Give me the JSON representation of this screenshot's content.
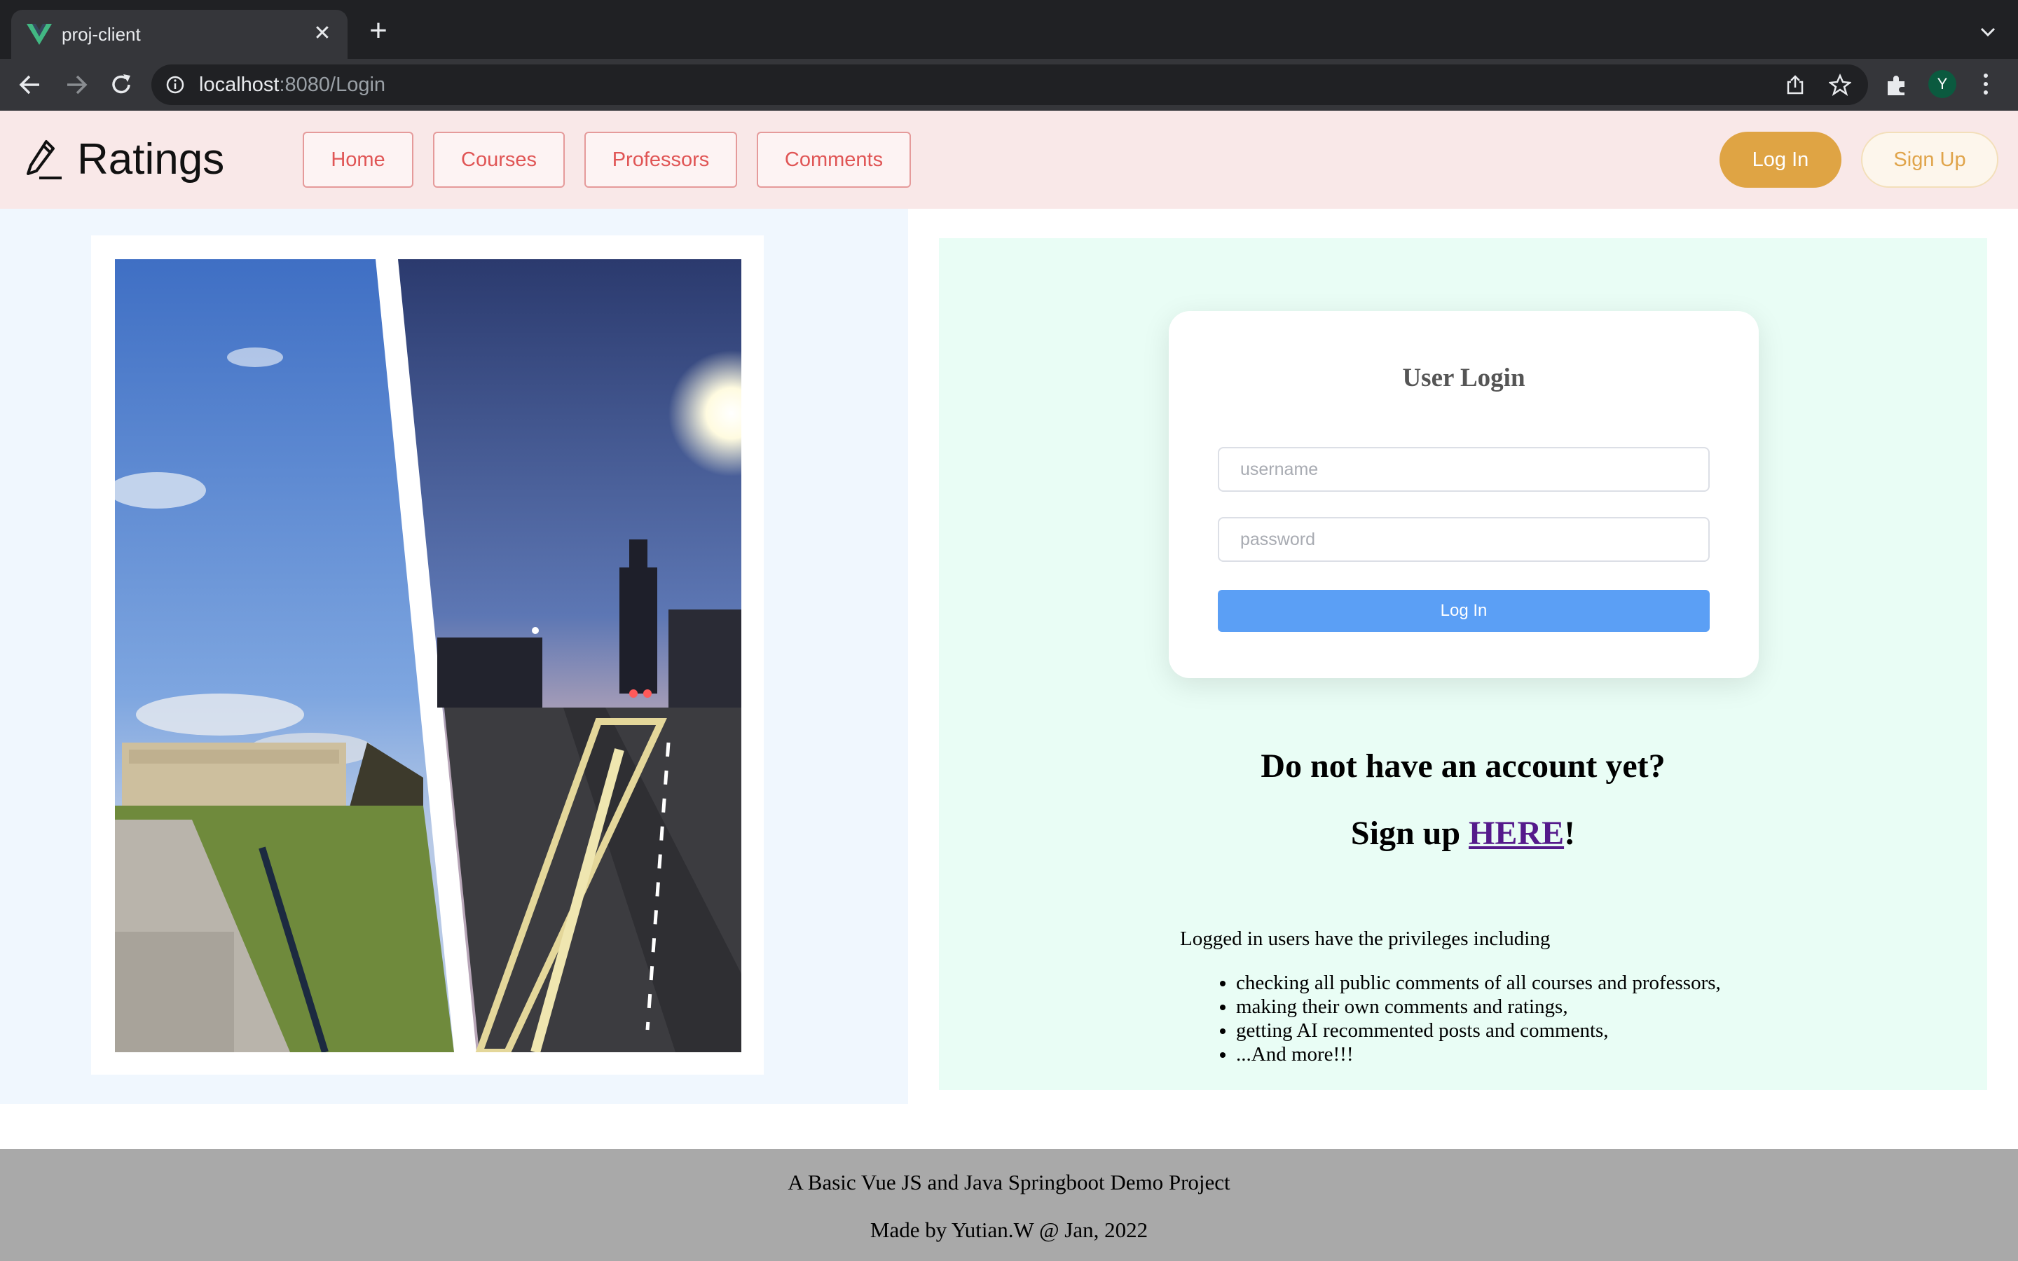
{
  "browser": {
    "tab_title": "proj-client",
    "url_host": "localhost",
    "url_rest": ":8080/Login",
    "profile_initial": "Y"
  },
  "header": {
    "logo_text": "Ratings",
    "nav": [
      "Home",
      "Courses",
      "Professors",
      "Comments"
    ],
    "login_label": "Log In",
    "signup_label": "Sign Up"
  },
  "login_card": {
    "title": "User Login",
    "username_placeholder": "username",
    "password_placeholder": "password",
    "submit_label": "Log In"
  },
  "signup_prompt": {
    "question": "Do not have an account yet?",
    "prefix": "Sign up ",
    "link_text": "HERE",
    "suffix": "!"
  },
  "privileges": {
    "intro": "Logged in users have the privileges including",
    "items": [
      "checking all public comments of all courses and professors,",
      "making their own comments and ratings,",
      "getting AI recommented posts and comments,",
      "...And more!!!"
    ]
  },
  "footer": {
    "line1": "A Basic Vue JS and Java Springboot Demo Project",
    "line2": "Made by Yutian.W @ Jan, 2022"
  },
  "colors": {
    "header_bg": "#f9e8e8",
    "nav_text": "#e05555",
    "login_btn": "#dfa444",
    "signup_text": "#e0a44a",
    "primary_blue": "#5b9ff5",
    "right_panel_bg": "#e9fdf5",
    "left_panel_bg": "#f0f7fe",
    "footer_bg": "#a9a9a9"
  }
}
